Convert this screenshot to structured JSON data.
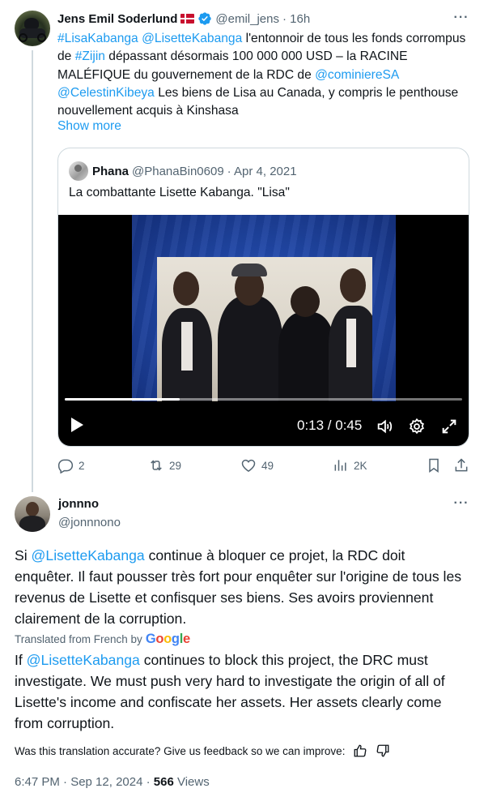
{
  "tweet1": {
    "author_name": "Jens Emil Soderlund",
    "handle": "@emil_jens",
    "time": "· 16h",
    "more_label": "···",
    "text_segments": [
      {
        "text": "#LisaKabanga",
        "link": true
      },
      {
        "text": " ",
        "link": false
      },
      {
        "text": "@LisetteKabanga",
        "link": true
      },
      {
        "text": " l'entonnoir de tous les fonds corrompus de ",
        "link": false
      },
      {
        "text": "#Zijin",
        "link": true
      },
      {
        "text": " dépassant désormais 100 000 000 USD – la RACINE MALÉFIQUE du gouvernement de la RDC de ",
        "link": false
      },
      {
        "text": "@cominiereSA",
        "link": true
      },
      {
        "text": " ",
        "link": false
      },
      {
        "text": "@CelestinKibeya",
        "link": true
      },
      {
        "text": " Les biens de Lisa au Canada, y compris le penthouse nouvellement acquis à Kinshasa",
        "link": false
      }
    ],
    "show_more": "Show more",
    "quote": {
      "author_name": "Phana",
      "handle": "@PhanaBin0609",
      "date": "· Apr 4, 2021",
      "text": "La combattante Lisette Kabanga. \"Lisa\"",
      "video": {
        "time_display": "0:13 / 0:45",
        "progress": 0.289
      }
    },
    "actions": {
      "replies": "2",
      "reposts": "29",
      "likes": "49",
      "views": "2K"
    }
  },
  "tweet2": {
    "author_name": "jonnno",
    "handle": "@jonnnono",
    "more_label": "···",
    "text_mention": "@LisetteKabanga",
    "text_prefix": "Si ",
    "text_suffix": " continue à bloquer ce projet, la RDC doit enquêter. Il faut pousser très fort pour enquêter sur l'origine de tous les revenus de Lisette et confisquer ses biens. Ses avoirs proviennent clairement de la corruption.",
    "translated_label": "Translated from French by",
    "google_label": "Google",
    "translation_prefix": "If ",
    "translation_mention": "@LisetteKabanga",
    "translation_suffix": " continues to block this project, the DRC must investigate. We must push very hard to investigate the origin of all of Lisette's income and confiscate her assets. Her assets clearly come from corruption.",
    "feedback_text": "Was this translation accurate? Give us feedback so we can improve:",
    "timestamp": "6:47 PM · Sep 12, 2024 · ",
    "views_count": "566",
    "views_label": " Views"
  },
  "colors": {
    "link": "#1d9bf0",
    "muted": "#536471",
    "text": "#0f1419",
    "border": "#cfd9de"
  }
}
